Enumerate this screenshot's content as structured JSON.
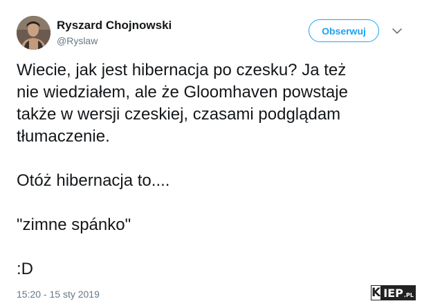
{
  "author": {
    "name": "Ryszard Chojnowski",
    "handle": "@Ryslaw"
  },
  "follow_label": "Obserwuj",
  "tweet": {
    "text": "Wiecie, jak jest hibernacja po czesku? Ja też\nnie wiedziałem, ale że Gloomhaven powstaje\ntakże w wersji czeskiej, czasami podglądam\ntłumaczenie.\n\nOtóż hibernacja to....\n\n\"zimne spánko\"\n\n:D",
    "timestamp": "15:20 - 15 sty 2019"
  },
  "watermark": {
    "k": "K",
    "rest": "IEP",
    "suffix": ".PL"
  },
  "icons": {
    "more": "chevron-down-icon"
  },
  "colors": {
    "accent": "#1da1f2",
    "text": "#14171a",
    "muted": "#657786"
  }
}
